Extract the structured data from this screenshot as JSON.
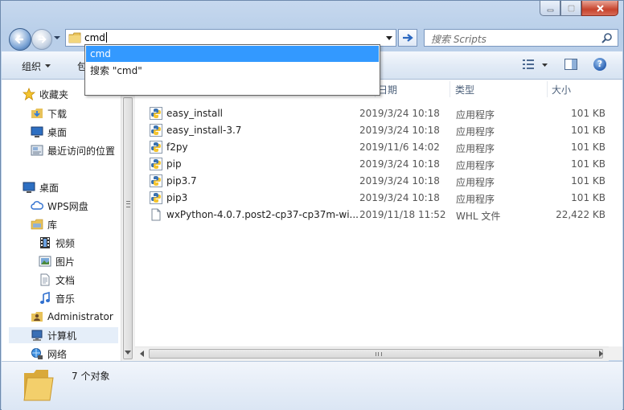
{
  "address": {
    "value": "cmd"
  },
  "search": {
    "placeholder": "搜索 Scripts"
  },
  "toolbar": {
    "organize_label": "组织",
    "partial_label": "包"
  },
  "autocomplete": {
    "items": [
      "cmd",
      "搜索 \"cmd\""
    ]
  },
  "navigation": {
    "items": [
      {
        "label": "收藏夹",
        "icon": "star-icon"
      },
      {
        "label": "下载",
        "icon": "download-folder-icon"
      },
      {
        "label": "桌面",
        "icon": "desktop-icon"
      },
      {
        "label": "最近访问的位置",
        "icon": "recent-places-icon"
      },
      {
        "label": "桌面",
        "icon": "desktop-icon"
      },
      {
        "label": "WPS网盘",
        "icon": "cloud-icon"
      },
      {
        "label": "库",
        "icon": "library-icon"
      },
      {
        "label": "视频",
        "icon": "video-icon"
      },
      {
        "label": "图片",
        "icon": "pictures-icon"
      },
      {
        "label": "文档",
        "icon": "documents-icon"
      },
      {
        "label": "音乐",
        "icon": "music-icon"
      },
      {
        "label": "Administrator",
        "icon": "user-folder-icon"
      },
      {
        "label": "计算机",
        "icon": "computer-icon"
      },
      {
        "label": "网络",
        "icon": "network-icon"
      }
    ]
  },
  "file_list": {
    "columns": [
      "日期",
      "类型",
      "大小"
    ],
    "rows": [
      {
        "name": "easy_install",
        "date": "2019/3/24 10:18",
        "type": "应用程序",
        "size": "101 KB",
        "icon": "python-exe-icon"
      },
      {
        "name": "easy_install-3.7",
        "date": "2019/3/24 10:18",
        "type": "应用程序",
        "size": "101 KB",
        "icon": "python-exe-icon"
      },
      {
        "name": "f2py",
        "date": "2019/11/6 14:02",
        "type": "应用程序",
        "size": "101 KB",
        "icon": "python-exe-icon"
      },
      {
        "name": "pip",
        "date": "2019/3/24 10:18",
        "type": "应用程序",
        "size": "101 KB",
        "icon": "python-exe-icon"
      },
      {
        "name": "pip3.7",
        "date": "2019/3/24 10:18",
        "type": "应用程序",
        "size": "101 KB",
        "icon": "python-exe-icon"
      },
      {
        "name": "pip3",
        "date": "2019/3/24 10:18",
        "type": "应用程序",
        "size": "101 KB",
        "icon": "python-exe-icon"
      },
      {
        "name": "wxPython-4.0.7.post2-cp37-cp37m-wi...",
        "date": "2019/11/18 11:52",
        "type": "WHL 文件",
        "size": "22,422 KB",
        "icon": "blank-file-icon"
      }
    ]
  },
  "status": {
    "count_text": "7 个对象"
  },
  "colors": {
    "highlight": "#3399ff",
    "frame": "#c6d8ee",
    "close_button": "#c7432d"
  }
}
